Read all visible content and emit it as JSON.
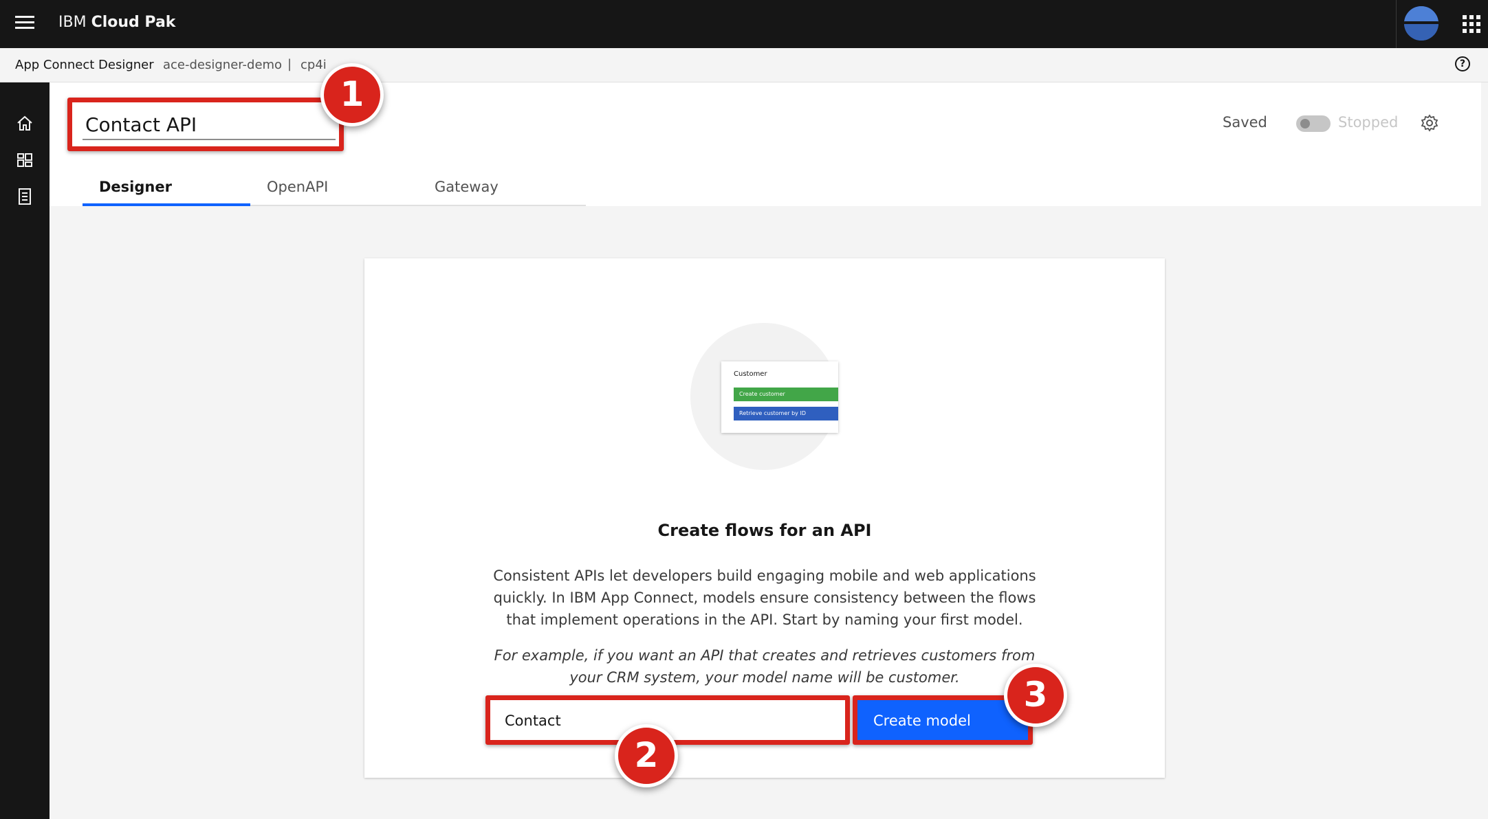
{
  "topbar": {
    "brand_prefix": "IBM",
    "brand_name": "Cloud Pak"
  },
  "subbar": {
    "app_name": "App Connect Designer",
    "instance": "ace-designer-demo",
    "separator": "|",
    "namespace": "cp4i",
    "help_glyph": "?"
  },
  "header": {
    "api_name": "Contact API",
    "save_status": "Saved",
    "run_status": "Stopped",
    "run_toggle_on": false
  },
  "tabs": [
    {
      "label": "Designer",
      "active": true
    },
    {
      "label": "OpenAPI",
      "active": false
    },
    {
      "label": "Gateway",
      "active": false
    }
  ],
  "illustration": {
    "title": "Customer",
    "row1": "Create customer",
    "row2": "Retrieve customer by ID"
  },
  "panel": {
    "heading": "Create flows for an API",
    "description": "Consistent APIs let developers build engaging mobile and web applications quickly. In IBM App Connect, models ensure consistency between the flows that implement operations in the API. Start by naming your first model.",
    "example": "For example, if you want an API that creates and retrieves customers from your CRM system, your model name will be customer.",
    "model_name_value": "Contact",
    "create_button_label": "Create model"
  },
  "annotations": {
    "badge1": "1",
    "badge2": "2",
    "badge3": "3"
  },
  "icons": {
    "menu": "hamburger-menu-icon",
    "user": "user-avatar-icon",
    "apps": "app-switcher-icon",
    "help": "help-icon",
    "home": "home-icon",
    "dashboard": "dashboard-icon",
    "catalog": "catalog-icon",
    "settings": "gear-icon"
  },
  "colors": {
    "accent": "#0f62fe",
    "annotation": "#d9241c",
    "shell": "#161616"
  }
}
